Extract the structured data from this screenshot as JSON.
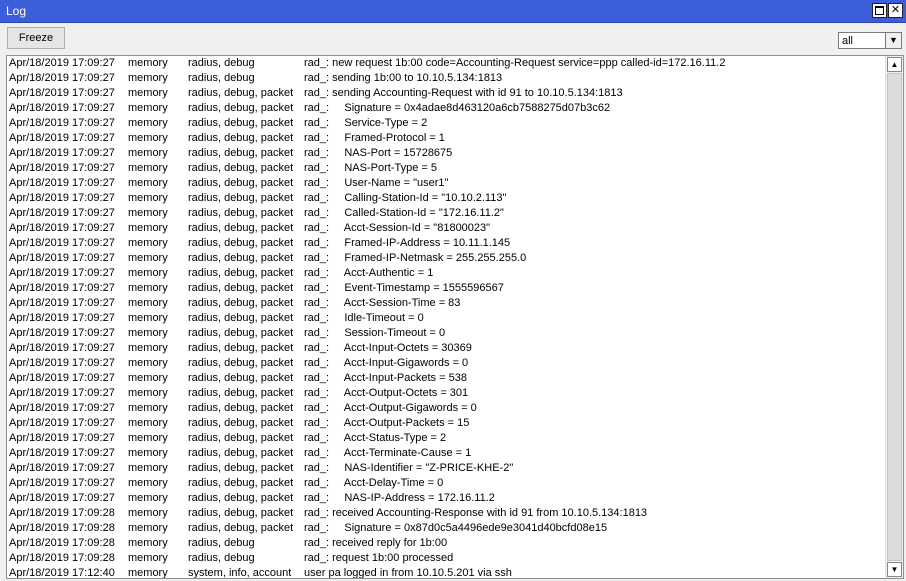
{
  "window": {
    "title": "Log"
  },
  "toolbar": {
    "freeze_label": "Freeze",
    "filter_value": "all"
  },
  "log": [
    {
      "time": "Apr/18/2019 17:09:27",
      "buffer": "memory",
      "topics": "radius, debug",
      "message": "rad_: new request 1b:00 code=Accounting-Request service=ppp called-id=172.16.11.2"
    },
    {
      "time": "Apr/18/2019 17:09:27",
      "buffer": "memory",
      "topics": "radius, debug",
      "message": "rad_: sending 1b:00 to 10.10.5.134:1813"
    },
    {
      "time": "Apr/18/2019 17:09:27",
      "buffer": "memory",
      "topics": "radius, debug, packet",
      "message": "rad_: sending Accounting-Request with id 91 to 10.10.5.134:1813"
    },
    {
      "time": "Apr/18/2019 17:09:27",
      "buffer": "memory",
      "topics": "radius, debug, packet",
      "message": "rad_:     Signature = 0x4adae8d463120a6cb7588275d07b3c62"
    },
    {
      "time": "Apr/18/2019 17:09:27",
      "buffer": "memory",
      "topics": "radius, debug, packet",
      "message": "rad_:     Service-Type = 2"
    },
    {
      "time": "Apr/18/2019 17:09:27",
      "buffer": "memory",
      "topics": "radius, debug, packet",
      "message": "rad_:     Framed-Protocol = 1"
    },
    {
      "time": "Apr/18/2019 17:09:27",
      "buffer": "memory",
      "topics": "radius, debug, packet",
      "message": "rad_:     NAS-Port = 15728675"
    },
    {
      "time": "Apr/18/2019 17:09:27",
      "buffer": "memory",
      "topics": "radius, debug, packet",
      "message": "rad_:     NAS-Port-Type = 5"
    },
    {
      "time": "Apr/18/2019 17:09:27",
      "buffer": "memory",
      "topics": "radius, debug, packet",
      "message": "rad_:     User-Name = \"user1\""
    },
    {
      "time": "Apr/18/2019 17:09:27",
      "buffer": "memory",
      "topics": "radius, debug, packet",
      "message": "rad_:     Calling-Station-Id = \"10.10.2.113\""
    },
    {
      "time": "Apr/18/2019 17:09:27",
      "buffer": "memory",
      "topics": "radius, debug, packet",
      "message": "rad_:     Called-Station-Id = \"172.16.11.2\""
    },
    {
      "time": "Apr/18/2019 17:09:27",
      "buffer": "memory",
      "topics": "radius, debug, packet",
      "message": "rad_:     Acct-Session-Id = \"81800023\""
    },
    {
      "time": "Apr/18/2019 17:09:27",
      "buffer": "memory",
      "topics": "radius, debug, packet",
      "message": "rad_:     Framed-IP-Address = 10.11.1.145"
    },
    {
      "time": "Apr/18/2019 17:09:27",
      "buffer": "memory",
      "topics": "radius, debug, packet",
      "message": "rad_:     Framed-IP-Netmask = 255.255.255.0"
    },
    {
      "time": "Apr/18/2019 17:09:27",
      "buffer": "memory",
      "topics": "radius, debug, packet",
      "message": "rad_:     Acct-Authentic = 1"
    },
    {
      "time": "Apr/18/2019 17:09:27",
      "buffer": "memory",
      "topics": "radius, debug, packet",
      "message": "rad_:     Event-Timestamp = 1555596567"
    },
    {
      "time": "Apr/18/2019 17:09:27",
      "buffer": "memory",
      "topics": "radius, debug, packet",
      "message": "rad_:     Acct-Session-Time = 83"
    },
    {
      "time": "Apr/18/2019 17:09:27",
      "buffer": "memory",
      "topics": "radius, debug, packet",
      "message": "rad_:     Idle-Timeout = 0"
    },
    {
      "time": "Apr/18/2019 17:09:27",
      "buffer": "memory",
      "topics": "radius, debug, packet",
      "message": "rad_:     Session-Timeout = 0"
    },
    {
      "time": "Apr/18/2019 17:09:27",
      "buffer": "memory",
      "topics": "radius, debug, packet",
      "message": "rad_:     Acct-Input-Octets = 30369"
    },
    {
      "time": "Apr/18/2019 17:09:27",
      "buffer": "memory",
      "topics": "radius, debug, packet",
      "message": "rad_:     Acct-Input-Gigawords = 0"
    },
    {
      "time": "Apr/18/2019 17:09:27",
      "buffer": "memory",
      "topics": "radius, debug, packet",
      "message": "rad_:     Acct-Input-Packets = 538"
    },
    {
      "time": "Apr/18/2019 17:09:27",
      "buffer": "memory",
      "topics": "radius, debug, packet",
      "message": "rad_:     Acct-Output-Octets = 301"
    },
    {
      "time": "Apr/18/2019 17:09:27",
      "buffer": "memory",
      "topics": "radius, debug, packet",
      "message": "rad_:     Acct-Output-Gigawords = 0"
    },
    {
      "time": "Apr/18/2019 17:09:27",
      "buffer": "memory",
      "topics": "radius, debug, packet",
      "message": "rad_:     Acct-Output-Packets = 15"
    },
    {
      "time": "Apr/18/2019 17:09:27",
      "buffer": "memory",
      "topics": "radius, debug, packet",
      "message": "rad_:     Acct-Status-Type = 2"
    },
    {
      "time": "Apr/18/2019 17:09:27",
      "buffer": "memory",
      "topics": "radius, debug, packet",
      "message": "rad_:     Acct-Terminate-Cause = 1"
    },
    {
      "time": "Apr/18/2019 17:09:27",
      "buffer": "memory",
      "topics": "radius, debug, packet",
      "message": "rad_:     NAS-Identifier = \"Z-PRICE-KHE-2\""
    },
    {
      "time": "Apr/18/2019 17:09:27",
      "buffer": "memory",
      "topics": "radius, debug, packet",
      "message": "rad_:     Acct-Delay-Time = 0"
    },
    {
      "time": "Apr/18/2019 17:09:27",
      "buffer": "memory",
      "topics": "radius, debug, packet",
      "message": "rad_:     NAS-IP-Address = 172.16.11.2"
    },
    {
      "time": "Apr/18/2019 17:09:28",
      "buffer": "memory",
      "topics": "radius, debug, packet",
      "message": "rad_: received Accounting-Response with id 91 from 10.10.5.134:1813"
    },
    {
      "time": "Apr/18/2019 17:09:28",
      "buffer": "memory",
      "topics": "radius, debug, packet",
      "message": "rad_:     Signature = 0x87d0c5a4496ede9e3041d40bcfd08e15"
    },
    {
      "time": "Apr/18/2019 17:09:28",
      "buffer": "memory",
      "topics": "radius, debug",
      "message": "rad_: received reply for 1b:00"
    },
    {
      "time": "Apr/18/2019 17:09:28",
      "buffer": "memory",
      "topics": "radius, debug",
      "message": "rad_: request 1b:00 processed"
    },
    {
      "time": "Apr/18/2019 17:12:40",
      "buffer": "memory",
      "topics": "system, info, account",
      "message": "user pa logged in from 10.10.5.201 via ssh"
    }
  ]
}
